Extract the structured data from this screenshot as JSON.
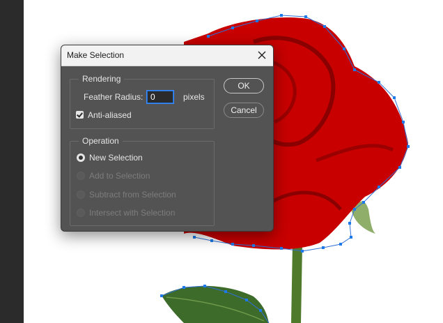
{
  "dialog": {
    "title": "Make Selection",
    "close_icon": "close-icon"
  },
  "rendering": {
    "legend": "Rendering",
    "feather_label": "Feather Radius:",
    "feather_value": "0",
    "feather_unit": "pixels",
    "anti_aliased_label": "Anti-aliased",
    "anti_aliased_checked": true
  },
  "operation": {
    "legend": "Operation",
    "options": [
      {
        "label": "New Selection",
        "selected": true,
        "enabled": true
      },
      {
        "label": "Add to Selection",
        "selected": false,
        "enabled": false
      },
      {
        "label": "Subtract from Selection",
        "selected": false,
        "enabled": false
      },
      {
        "label": "Intersect with Selection",
        "selected": false,
        "enabled": false
      }
    ]
  },
  "buttons": {
    "ok": "OK",
    "cancel": "Cancel"
  },
  "colors": {
    "dialog_bg": "#535353",
    "path_anchor": "#1e7ae8",
    "rose_red": "#cc0000"
  }
}
